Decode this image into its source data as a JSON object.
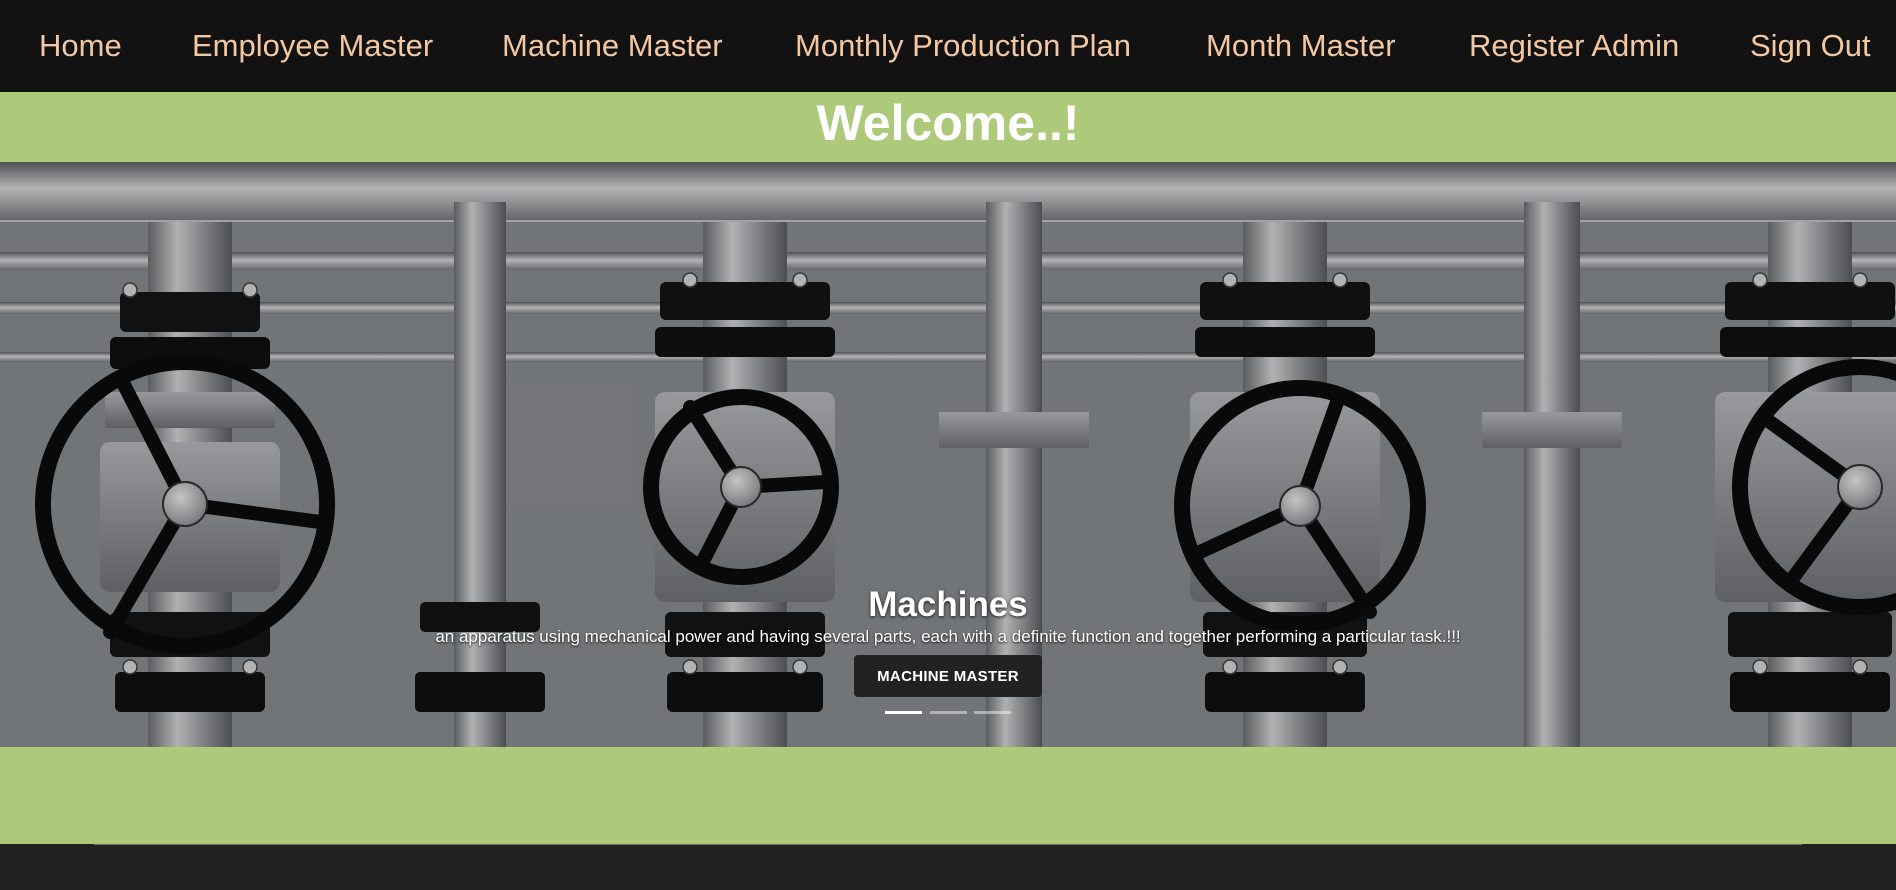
{
  "nav": {
    "items": [
      {
        "label": "Home"
      },
      {
        "label": "Employee Master"
      },
      {
        "label": "Machine Master"
      },
      {
        "label": "Monthly Production Plan"
      },
      {
        "label": "Month Master"
      },
      {
        "label": "Register Admin"
      },
      {
        "label": "Sign Out"
      }
    ]
  },
  "welcome": {
    "title": "Welcome..!"
  },
  "carousel": {
    "title": "Machines",
    "text": "an apparatus using mechanical power and having several parts, each with a definite function and together performing a particular task.!!!",
    "button_label": "MACHINE MASTER",
    "slide_count": 3,
    "active_slide": 1
  },
  "colors": {
    "navbar_bg": "#121212",
    "nav_text": "#f3c7a1",
    "band_green": "#acca7a",
    "footer_bg": "#222222"
  }
}
